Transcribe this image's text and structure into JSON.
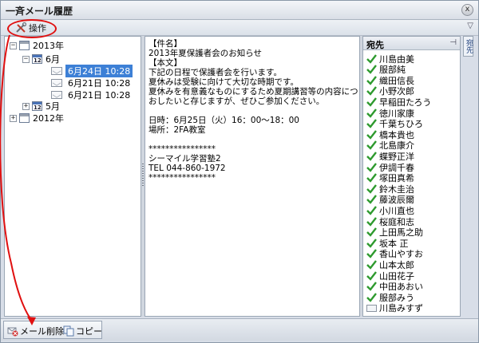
{
  "window": {
    "title": "一斉メール履歴",
    "close_label": "x"
  },
  "toolbar": {
    "operation_label": "操作",
    "collapse_symbol": "▽"
  },
  "tree": {
    "year_2013": {
      "label": "2013年",
      "toggle": "−"
    },
    "month_june": {
      "label": "6月",
      "toggle": "−",
      "day_badge": "12"
    },
    "messages": [
      {
        "label": "6月24日 10:28",
        "selected": true
      },
      {
        "label": "6月21日 10:28",
        "selected": false
      },
      {
        "label": "6月21日 10:28",
        "selected": false
      }
    ],
    "month_may": {
      "label": "5月",
      "toggle": "+",
      "day_badge": "12"
    },
    "year_2012": {
      "label": "2012年",
      "toggle": "+"
    }
  },
  "message": {
    "lines": [
      "【件名】",
      "2013年夏保護者会のお知らせ",
      "【本文】",
      "下記の日程で保護者会を行います。",
      "夏休みは受験に向けて大切な時期です。",
      "夏休みを有意義なものにするため夏期講習等の内容についてお知",
      "おしたいと存じますが、ぜひご参加ください。",
      "",
      "日時：6月25日（火）16：00～18：00",
      "場所：2FA教室",
      "",
      "****************",
      "シーマイル学習塾2",
      "TEL 044-860-1972",
      "****************"
    ]
  },
  "recipients": {
    "header": "宛先",
    "pin_symbol": "⊣",
    "items": [
      {
        "name": "川島由美",
        "checked": true
      },
      {
        "name": "服部純",
        "checked": true
      },
      {
        "name": "織田信長",
        "checked": true
      },
      {
        "name": "小野次郎",
        "checked": true
      },
      {
        "name": "早稲田たろう",
        "checked": true
      },
      {
        "name": "徳川家康",
        "checked": true
      },
      {
        "name": "千葉ちひろ",
        "checked": true
      },
      {
        "name": "橋本貴也",
        "checked": true
      },
      {
        "name": "北島康介",
        "checked": true
      },
      {
        "name": "蝶野正洋",
        "checked": true
      },
      {
        "name": "伊調千春",
        "checked": true
      },
      {
        "name": "塚田真希",
        "checked": true
      },
      {
        "name": "鈴木圭治",
        "checked": true
      },
      {
        "name": "藤波辰爾",
        "checked": true
      },
      {
        "name": "小川直也",
        "checked": true
      },
      {
        "name": "桜庭和志",
        "checked": true
      },
      {
        "name": "上田馬之助",
        "checked": true
      },
      {
        "name": "坂本 正",
        "checked": true
      },
      {
        "name": "香山やすお",
        "checked": true
      },
      {
        "name": "山本太郎",
        "checked": true
      },
      {
        "name": "山田花子",
        "checked": true
      },
      {
        "name": "中田あおい",
        "checked": true
      },
      {
        "name": "服部みう",
        "checked": true
      },
      {
        "name": "川島みすず",
        "checked": false
      }
    ]
  },
  "side_tab": {
    "label": "宛先"
  },
  "bottom": {
    "delete_label": "メール削除",
    "copy_label": "コピー"
  },
  "colors": {
    "selection": "#3d80d6",
    "annotation_red": "#e01010",
    "check_green": "#2e9a2e"
  }
}
